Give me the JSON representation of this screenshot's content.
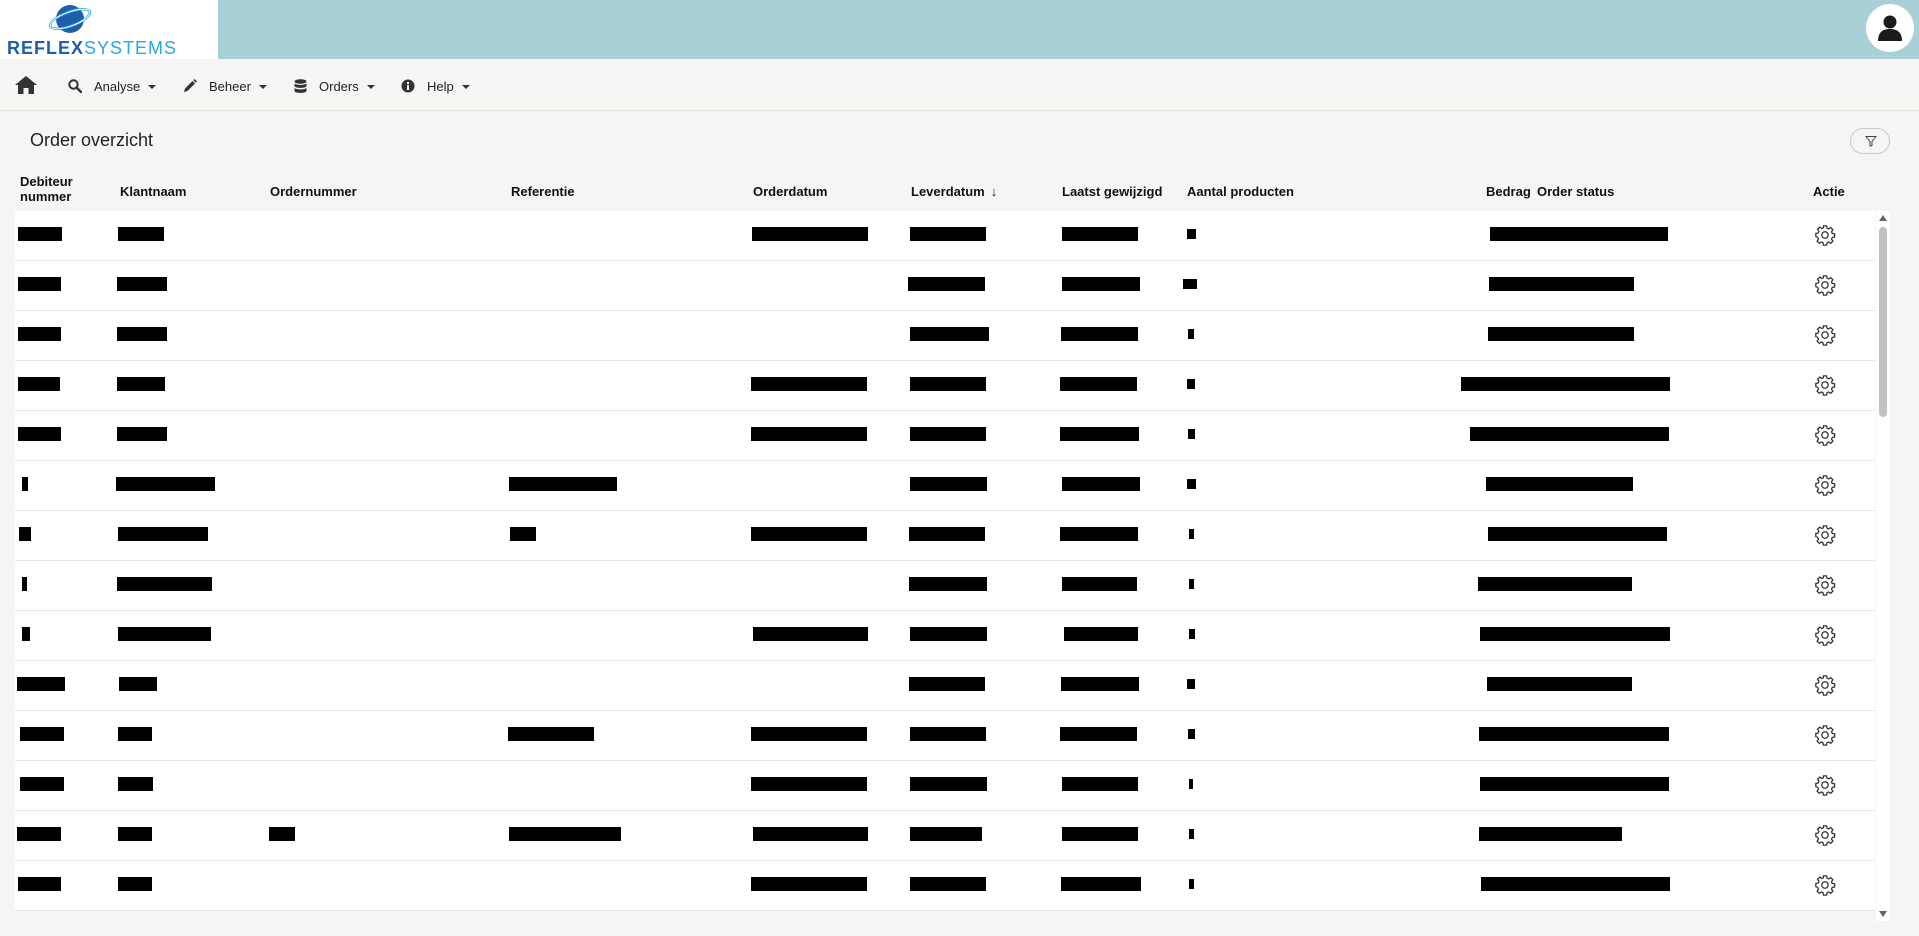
{
  "brand": {
    "logo_text_bold": "REFLEX",
    "logo_text_light": "SYSTEMS"
  },
  "nav": {
    "home_icon": "home-icon",
    "items": [
      {
        "label": "Analyse",
        "icon": "search-icon"
      },
      {
        "label": "Beheer",
        "icon": "pencil-icon"
      },
      {
        "label": "Orders",
        "icon": "database-icon"
      },
      {
        "label": "Help",
        "icon": "info-icon"
      }
    ]
  },
  "page": {
    "title": "Order overzicht",
    "filter_icon": "filter-icon"
  },
  "table": {
    "columns": {
      "debiteur_line1": "Debiteur",
      "debiteur_line2": "nummer",
      "klantnaam": "Klantnaam",
      "ordernummer": "Ordernummer",
      "referentie": "Referentie",
      "orderdatum": "Orderdatum",
      "leverdatum": "Leverdatum",
      "leverdatum_sort": "↓",
      "laatst_gewijzigd": "Laatst gewijzigd",
      "aantal_producten": "Aantal producten",
      "bedrag": "Bedrag",
      "order_status": "Order status",
      "actie": "Actie"
    },
    "redacted_note": "All cell values in the screenshot are redacted with black boxes",
    "row_count": 14,
    "action_icon": "gear-icon"
  },
  "colors": {
    "header_bg": "#a8d0d6",
    "page_bg": "#f6f5f3",
    "logo_blue": "#1f5fa9",
    "logo_light_blue": "#2aa6e0"
  }
}
